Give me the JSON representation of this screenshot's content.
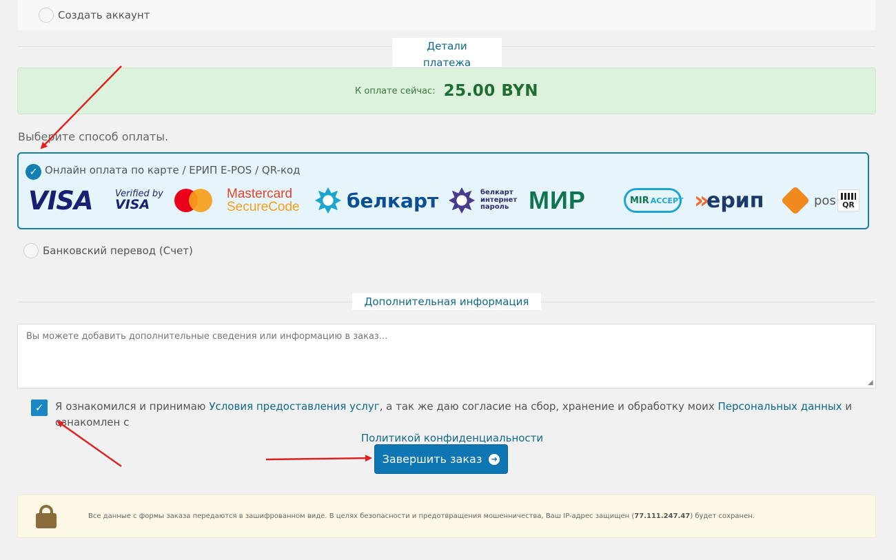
{
  "account": {
    "create_label": "Создать аккаунт"
  },
  "sections": {
    "payment_details": "Детали платежа",
    "additional_info": "Дополнительная информация"
  },
  "payment": {
    "amount_label": "К оплате сейчас:",
    "amount_value": "25.00 BYN",
    "choose_label": "Выберите способ оплаты.",
    "method_online": "Онлайн оплата по карте / ЕРИП E-POS / QR-код",
    "method_bank": "Банковский перевод (Счет)",
    "logos": {
      "visa": "VISA",
      "vbv_top": "Verified by",
      "vbv_bottom": "VISA",
      "mc_sc_top": "Mastercard",
      "mc_sc_bottom": "SecureCode",
      "belkart": "белкарт",
      "bip_1": "белкарт",
      "bip_2": "интернет",
      "bip_3": "пароль",
      "mir": "МИР",
      "mir_accept_1": "MIR",
      "mir_accept_2": "ACCEPT",
      "erip": "ерип",
      "epos": "pos",
      "qr": "QR"
    }
  },
  "notes": {
    "placeholder": "Вы можете добавить дополнительные сведения или информацию в заказ..."
  },
  "terms": {
    "part1": "Я ознакомился и принимаю ",
    "link_terms": "Условия предоставления услуг",
    "part2": ", а так же даю согласие на сбор, хранение и обработку моих ",
    "link_personal": "Персональных данных",
    "part3": " и ознакомлен с",
    "link_privacy": "Политикой конфиденциальности"
  },
  "submit": {
    "label": "Завершить заказ"
  },
  "security": {
    "message_before": "Все данные с формы заказа передаются в зашифрованном виде. В целях безопасности и предотвращения мошенничества, Ваш IP-адрес защищен (",
    "ip": "77.111.247.47",
    "message_after": ") будет сохранен."
  },
  "colors": {
    "accent": "#0d76b3",
    "link": "#0e6a8c",
    "amount_bg": "#dcf2dc",
    "amount_text": "#1f6d33",
    "selected_border": "#157fa9",
    "notice_bg": "#fdf8e6",
    "annotation_arrow": "#e02020"
  }
}
